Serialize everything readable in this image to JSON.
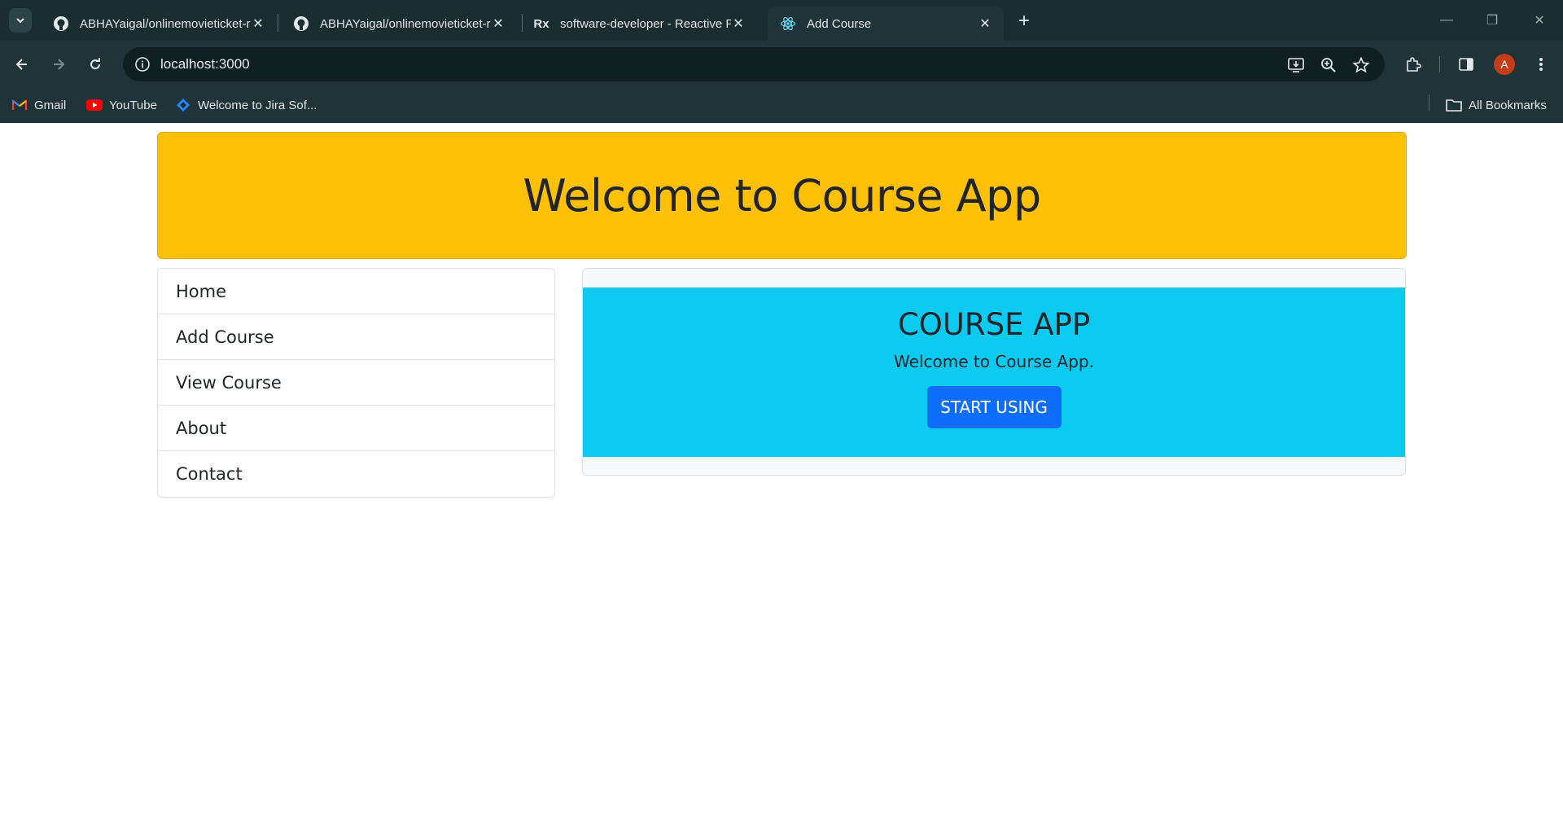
{
  "browser": {
    "tabs": [
      {
        "label": "ABHAYaigal/onlinemovieticket-r",
        "icon": "github-icon",
        "active": false
      },
      {
        "label": "ABHAYaigal/onlinemovieticket-r",
        "icon": "github-icon",
        "active": false
      },
      {
        "label": "software-developer - Reactive P",
        "icon": "rx-icon",
        "active": false
      },
      {
        "label": "Add Course",
        "icon": "react-icon",
        "active": true
      }
    ],
    "url": "localhost:3000",
    "avatar_letter": "A",
    "bookmarks": [
      {
        "label": "Gmail",
        "icon": "gmail-icon"
      },
      {
        "label": "YouTube",
        "icon": "youtube-icon"
      },
      {
        "label": "Welcome to Jira Sof...",
        "icon": "jira-icon"
      }
    ],
    "all_bookmarks_label": "All Bookmarks"
  },
  "page": {
    "header_title": "Welcome to Course App",
    "menu": [
      {
        "label": "Home"
      },
      {
        "label": "Add Course"
      },
      {
        "label": "View Course"
      },
      {
        "label": "About"
      },
      {
        "label": "Contact"
      }
    ],
    "hero": {
      "title": "COURSE APP",
      "text": "Welcome to Course App.",
      "button_label": "START USING"
    }
  },
  "colors": {
    "header_bg": "#ffc107",
    "hero_bg": "#0dcaf0",
    "button_bg": "#0d6efd",
    "chrome_bg": "#1f3438"
  }
}
